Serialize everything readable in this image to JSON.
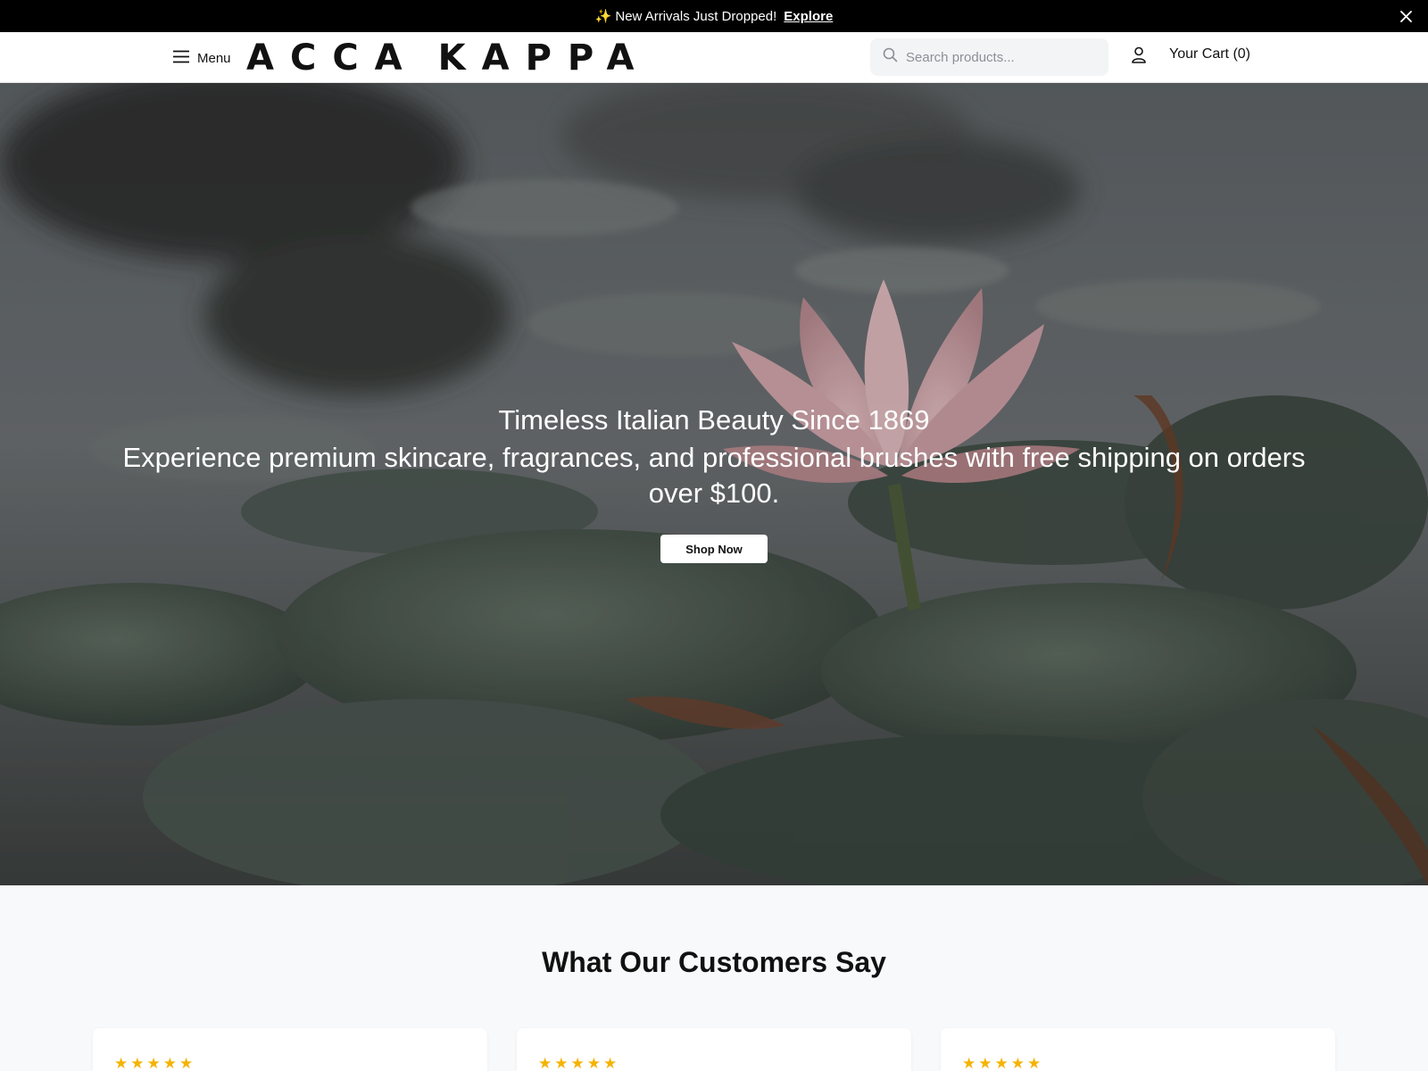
{
  "announcement": {
    "icon": "sparkles-icon",
    "spark": "✨",
    "text": "New Arrivals Just Dropped!",
    "link_label": "Explore",
    "close_icon": "close-icon"
  },
  "header": {
    "menu_label": "Menu",
    "logo_word1": "ACCA",
    "logo_word2": "KAPPA",
    "search_placeholder": "Search products...",
    "cart_label": "Your Cart (0)"
  },
  "hero": {
    "title": "Timeless Italian Beauty Since 1869",
    "subtitle": "Experience premium skincare, fragrances, and professional brushes with free shipping on orders over $100.",
    "cta_label": "Shop Now"
  },
  "reviews": {
    "title": "What Our Customers Say",
    "cards": [
      {
        "stars": "★★★★★",
        "rating": 5
      },
      {
        "stars": "★★★★★",
        "rating": 5
      },
      {
        "stars": "★★★★★",
        "rating": 5
      }
    ]
  },
  "colors": {
    "announcement_bg": "#000000",
    "star": "#f5b301",
    "page_bg": "#f8f9fb"
  }
}
